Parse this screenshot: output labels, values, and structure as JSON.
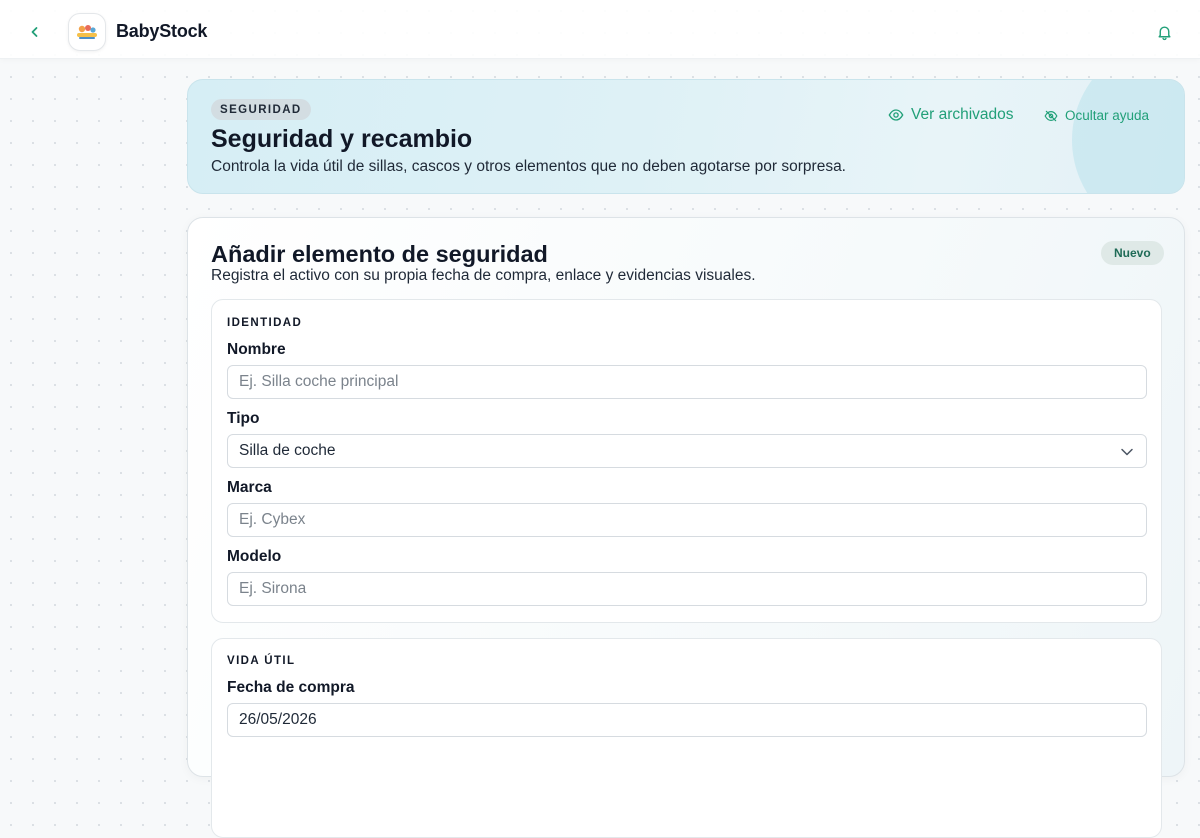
{
  "app": {
    "brand": "BabyStock",
    "colors": {
      "accent": "#22a079",
      "badge_bg": "#dfe9e7",
      "hero_bg": "#d6eef5"
    },
    "icons": {
      "back": "chevron-left-icon",
      "logo": "babystock-logo",
      "notifications": "bell-icon"
    }
  },
  "hero": {
    "badge": "SEGURIDAD",
    "title": "Seguridad y recambio",
    "subtitle": "Controla la vida útil de sillas, cascos y otros elementos que no deben agotarse por sorpresa.",
    "archived_link": "Ver archivados",
    "help_link": "Ocultar ayuda"
  },
  "form": {
    "title": "Añadir elemento de seguridad",
    "subtitle": "Registra el activo con su propia fecha de compra, enlace y evidencias visuales.",
    "badge": "Nuevo",
    "identity": {
      "section_title": "IDENTIDAD",
      "name_label": "Nombre",
      "name_placeholder": "Ej. Silla coche principal",
      "type_label": "Tipo",
      "type_value": "Silla de coche",
      "brand_label": "Marca",
      "brand_placeholder": "Ej. Cybex",
      "model_label": "Modelo",
      "model_placeholder": "Ej. Sirona"
    },
    "life": {
      "section_title": "VIDA ÚTIL",
      "purchase_label": "Fecha de compra",
      "purchase_value": "26/05/2026"
    }
  }
}
